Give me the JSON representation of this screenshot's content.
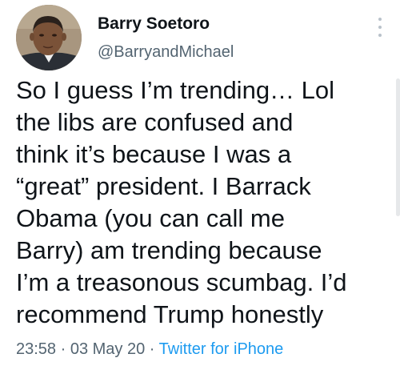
{
  "author": {
    "display_name": "Barry Soetoro",
    "handle": "@BarryandMichael",
    "avatar_icon": "profile-photo"
  },
  "more_icon": "more-vertical-icon",
  "tweet": {
    "lines": [
      "So I guess I’m trending… Lol",
      "the libs are confused and",
      "think it’s because I was a",
      "“great” president. I Barrack",
      "Obama (you can call me",
      "Barry) am trending because",
      "I’m a treasonous scumbag. I’d",
      "recommend Trump honestly"
    ]
  },
  "meta": {
    "time": "23:58",
    "separator": " · ",
    "date": "03 May 20",
    "source": "Twitter for iPhone"
  },
  "colors": {
    "text": "#0f1419",
    "secondary": "#536471",
    "link": "#1d9bf0"
  }
}
